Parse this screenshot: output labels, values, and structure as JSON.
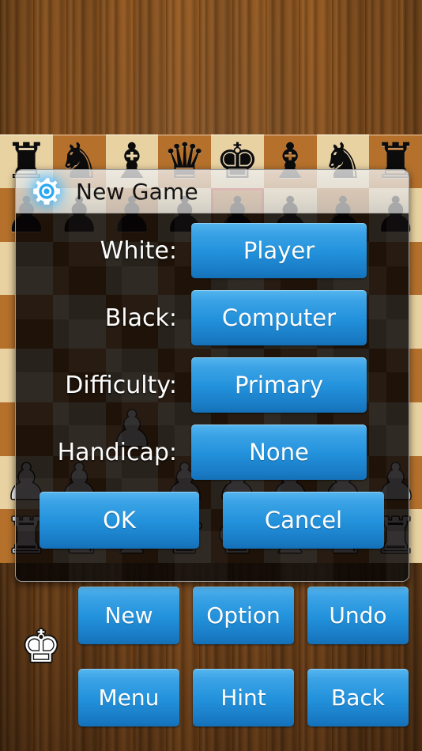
{
  "app": {
    "background": "wood",
    "accent_color": "#2392dc",
    "board_light_color": "#e9d2a2",
    "board_dark_color": "#b5712c"
  },
  "board": {
    "rows": [
      [
        "r",
        "n",
        "b",
        "q",
        "k",
        "b",
        "n",
        "r"
      ],
      [
        "p",
        "p",
        "p",
        "p",
        "p",
        "p",
        "p",
        "p"
      ],
      [
        "",
        "",
        "",
        "",
        "",
        "",
        "",
        ""
      ],
      [
        "",
        "",
        "",
        "",
        "",
        "",
        "",
        ""
      ],
      [
        "",
        "",
        "",
        "",
        "",
        "",
        "",
        ""
      ],
      [
        "",
        "",
        "P",
        "",
        "",
        "",
        "",
        ""
      ],
      [
        "P",
        "P",
        "",
        "P",
        "P",
        "P",
        "P",
        "P"
      ],
      [
        "R",
        "N",
        "B",
        "Q",
        "K",
        "B",
        "N",
        "R"
      ]
    ],
    "glyphs": {
      "r": "♜",
      "n": "♞",
      "b": "♝",
      "q": "♛",
      "k": "♚",
      "p": "♟",
      "R": "♜",
      "N": "♞",
      "B": "♝",
      "Q": "♛",
      "K": "♚",
      "P": "♟"
    },
    "highlight_square": {
      "row": 1,
      "col": 4
    }
  },
  "captured": {
    "piece_glyph": "♚",
    "piece_name": "white-king"
  },
  "dialog": {
    "icon": "gear-icon",
    "title": "New Game",
    "rows": [
      {
        "label": "White:",
        "value": "Player"
      },
      {
        "label": "Black:",
        "value": "Computer"
      },
      {
        "label": "Difficulty:",
        "value": "Primary"
      },
      {
        "label": "Handicap:",
        "value": "None"
      }
    ],
    "ok_label": "OK",
    "cancel_label": "Cancel"
  },
  "toolbar": {
    "row1": [
      {
        "label": "New",
        "name": "new-button"
      },
      {
        "label": "Option",
        "name": "option-button"
      },
      {
        "label": "Undo",
        "name": "undo-button"
      }
    ],
    "row2": [
      {
        "label": "Menu",
        "name": "menu-button"
      },
      {
        "label": "Hint",
        "name": "hint-button"
      },
      {
        "label": "Back",
        "name": "back-button"
      }
    ]
  }
}
